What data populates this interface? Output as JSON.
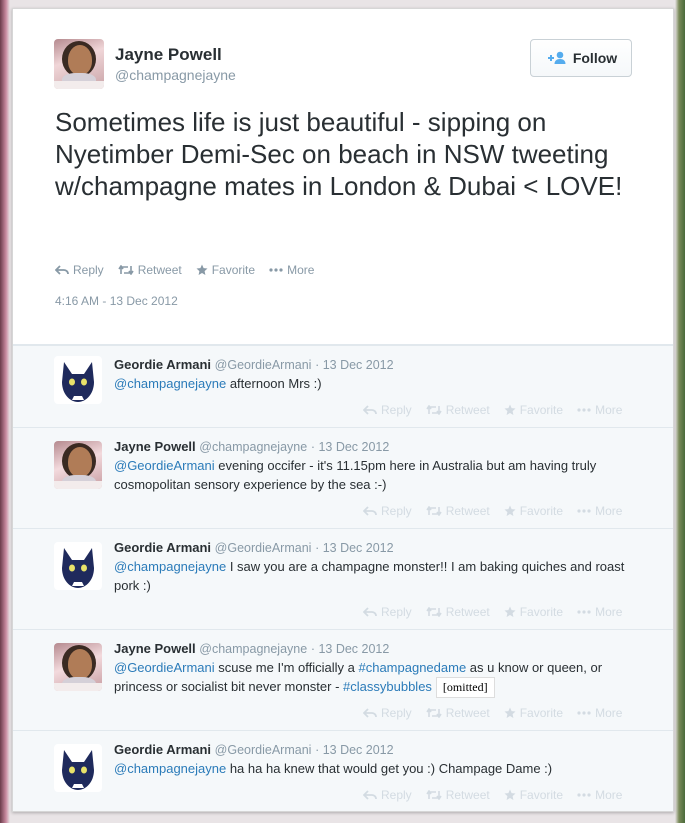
{
  "main_tweet": {
    "name": "Jayne Powell",
    "handle": "@champagnejayne",
    "follow_label": "Follow",
    "text": "Sometimes life is just beautiful - sipping on Nyetimber Demi-Sec on beach in NSW tweeting w/champagne mates in London & Dubai < LOVE!",
    "actions": {
      "reply": "Reply",
      "retweet": "Retweet",
      "favorite": "Favorite",
      "more": "More"
    },
    "timestamp": "4:16 AM - 13 Dec 2012"
  },
  "replies": [
    {
      "name": "Geordie Armani",
      "handle": "@GeordieArmani",
      "date": "· 13 Dec 2012",
      "mention": "@champagnejayne",
      "text": " afternoon Mrs :)"
    },
    {
      "name": "Jayne Powell",
      "handle": "@champagnejayne",
      "date": "· 13 Dec 2012",
      "mention": "@GeordieArmani",
      "text": " evening occifer - it's 11.15pm here in Australia but am having truly cosmopolitan sensory experience by the sea :-)"
    },
    {
      "name": "Geordie Armani",
      "handle": "@GeordieArmani",
      "date": "· 13 Dec 2012",
      "mention": "@champagnejayne",
      "text": " I saw you are a champagne monster!! I am baking quiches and roast pork :)"
    },
    {
      "name": "Jayne Powell",
      "handle": "@champagnejayne",
      "date": "· 13 Dec 2012",
      "mention": "@GeordieArmani",
      "text_a": " scuse me I'm officially a ",
      "hashtag1": "#champagnedame",
      "text_b": " as u know or queen, or princess or socialist bit never monster - ",
      "hashtag2": "#classybubbles",
      "omitted": "[omitted]"
    },
    {
      "name": "Geordie Armani",
      "handle": "@GeordieArmani",
      "date": "· 13 Dec 2012",
      "mention": "@champagnejayne",
      "text": " ha ha ha knew that would get you :) Champage Dame :)"
    }
  ],
  "reply_actions": {
    "reply": "Reply",
    "retweet": "Retweet",
    "favorite": "Favorite",
    "more": "More"
  },
  "colors": {
    "link": "#2b7bb9",
    "muted": "#8899a6",
    "text": "#292f33",
    "cat": "#1f2a5c"
  }
}
